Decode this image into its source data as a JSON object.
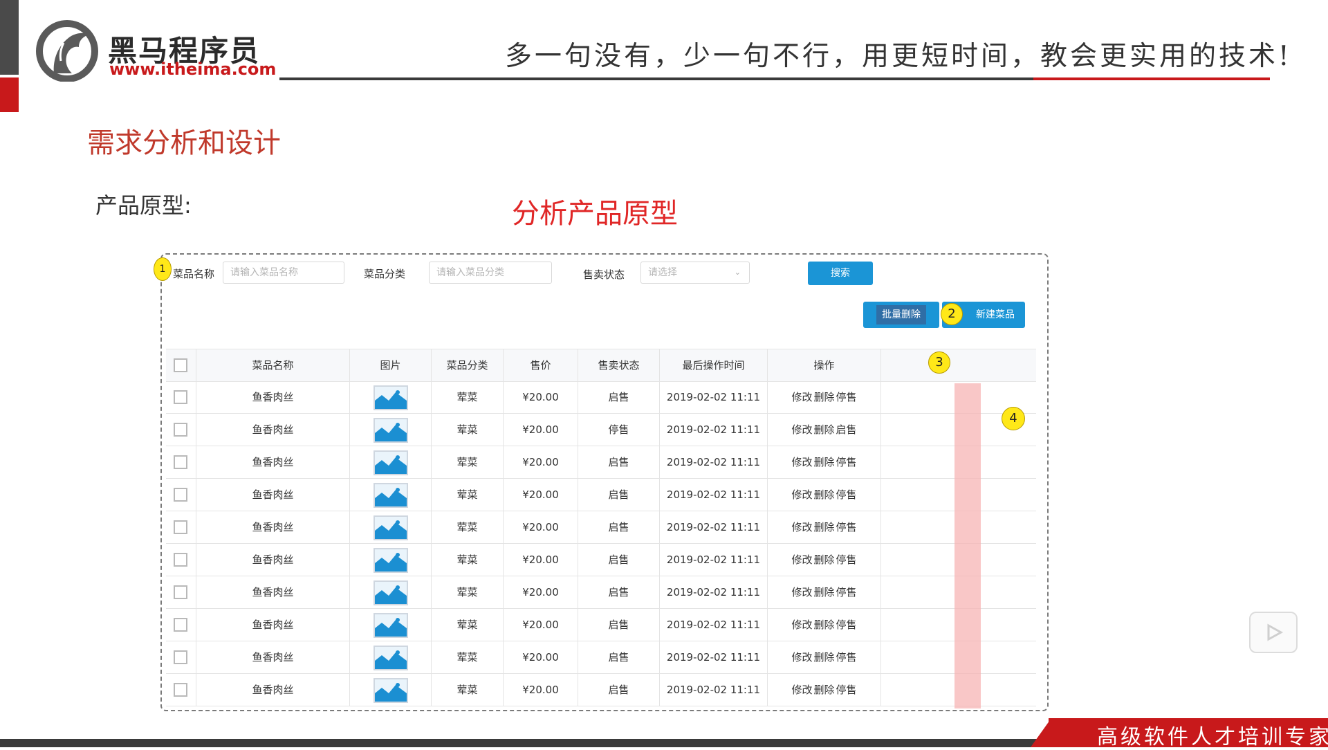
{
  "brand": {
    "name": "黑马程序员",
    "url": "www.itheima.com"
  },
  "slogan": "多一句没有，少一句不行，用更短时间，教会更实用的技术!",
  "section_title": "需求分析和设计",
  "prototype_label": "产品原型:",
  "analysis_label": "分析产品原型",
  "filters": {
    "name_label": "菜品名称",
    "name_placeholder": "请输入菜品名称",
    "category_label": "菜品分类",
    "category_placeholder": "请输入菜品分类",
    "status_label": "售卖状态",
    "status_placeholder": "请选择",
    "search_button": "搜索"
  },
  "actions": {
    "batch_delete": "批量删除",
    "new_dish": "新建菜品"
  },
  "markers": [
    "1",
    "2",
    "3",
    "4"
  ],
  "table": {
    "columns": [
      "菜品名称",
      "图片",
      "菜品分类",
      "售价",
      "售卖状态",
      "最后操作时间",
      "操作"
    ],
    "ops": {
      "edit": "修改",
      "delete": "删除"
    },
    "rows": [
      {
        "name": "鱼香肉丝",
        "category": "荤菜",
        "price": "¥20.00",
        "status": "启售",
        "time": "2019-02-02 11:11",
        "toggle": "停售"
      },
      {
        "name": "鱼香肉丝",
        "category": "荤菜",
        "price": "¥20.00",
        "status": "停售",
        "time": "2019-02-02 11:11",
        "toggle": "启售"
      },
      {
        "name": "鱼香肉丝",
        "category": "荤菜",
        "price": "¥20.00",
        "status": "启售",
        "time": "2019-02-02 11:11",
        "toggle": "停售"
      },
      {
        "name": "鱼香肉丝",
        "category": "荤菜",
        "price": "¥20.00",
        "status": "启售",
        "time": "2019-02-02 11:11",
        "toggle": "停售"
      },
      {
        "name": "鱼香肉丝",
        "category": "荤菜",
        "price": "¥20.00",
        "status": "启售",
        "time": "2019-02-02 11:11",
        "toggle": "停售"
      },
      {
        "name": "鱼香肉丝",
        "category": "荤菜",
        "price": "¥20.00",
        "status": "启售",
        "time": "2019-02-02 11:11",
        "toggle": "停售"
      },
      {
        "name": "鱼香肉丝",
        "category": "荤菜",
        "price": "¥20.00",
        "status": "启售",
        "time": "2019-02-02 11:11",
        "toggle": "停售"
      },
      {
        "name": "鱼香肉丝",
        "category": "荤菜",
        "price": "¥20.00",
        "status": "启售",
        "time": "2019-02-02 11:11",
        "toggle": "停售"
      },
      {
        "name": "鱼香肉丝",
        "category": "荤菜",
        "price": "¥20.00",
        "status": "启售",
        "time": "2019-02-02 11:11",
        "toggle": "停售"
      },
      {
        "name": "鱼香肉丝",
        "category": "荤菜",
        "price": "¥20.00",
        "status": "启售",
        "time": "2019-02-02 11:11",
        "toggle": "停售"
      }
    ]
  },
  "footer_tagline": "高级软件人才培训专家",
  "colors": {
    "brand_red": "#c8191b",
    "primary_blue": "#1b95d6",
    "marker_yellow": "#ffe818",
    "highlight": "#f7b4b4"
  }
}
